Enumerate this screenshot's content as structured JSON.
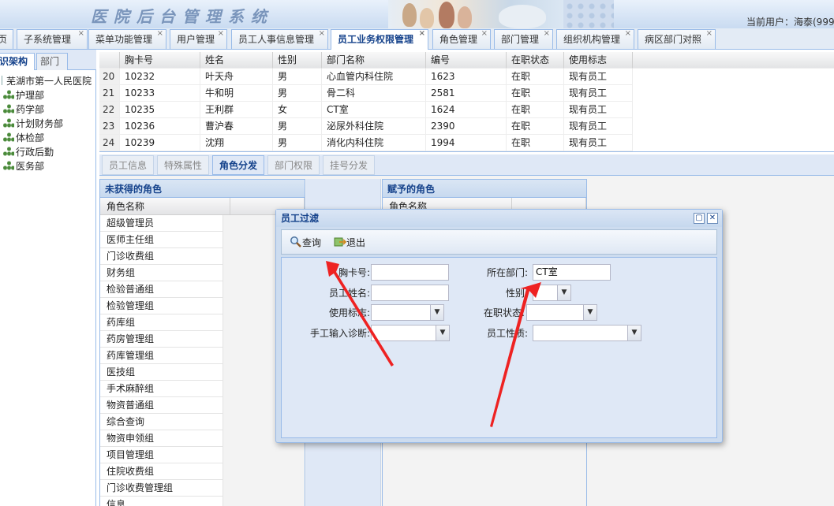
{
  "banner": {
    "title": "医院后台管理系统",
    "current_user": "当前用户：海泰(999"
  },
  "top_tabs": [
    {
      "label": "页",
      "active": false
    },
    {
      "label": "子系统管理",
      "active": false
    },
    {
      "label": "菜单功能管理",
      "active": false
    },
    {
      "label": "用户管理",
      "active": false
    },
    {
      "label": "员工人事信息管理",
      "active": false
    },
    {
      "label": "员工业务权限管理",
      "active": true
    },
    {
      "label": "角色管理",
      "active": false
    },
    {
      "label": "部门管理",
      "active": false
    },
    {
      "label": "组织机构管理",
      "active": false
    },
    {
      "label": "病区部门对照",
      "active": false
    }
  ],
  "left_panel": {
    "tabs": [
      "识架构",
      "部门"
    ],
    "root": "芜湖市第一人民医院",
    "nodes": [
      "护理部",
      "药学部",
      "计划财务部",
      "体检部",
      "行政后勤",
      "医务部"
    ]
  },
  "grid": {
    "headers": [
      "胸卡号",
      "姓名",
      "性别",
      "部门名称",
      "编号",
      "在职状态",
      "使用标志"
    ],
    "rows": [
      {
        "num": "20",
        "cells": [
          "10232",
          "叶天舟",
          "男",
          "心血管内科住院",
          "1623",
          "在职",
          "现有员工"
        ]
      },
      {
        "num": "21",
        "cells": [
          "10233",
          "牛和明",
          "男",
          "骨二科",
          "2581",
          "在职",
          "现有员工"
        ]
      },
      {
        "num": "22",
        "cells": [
          "10235",
          "王利群",
          "女",
          "CT室",
          "1624",
          "在职",
          "现有员工"
        ]
      },
      {
        "num": "23",
        "cells": [
          "10236",
          "曹沪春",
          "男",
          "泌尿外科住院",
          "2390",
          "在职",
          "现有员工"
        ]
      },
      {
        "num": "24",
        "cells": [
          "10239",
          "沈翔",
          "男",
          "消化内科住院",
          "1994",
          "在职",
          "现有员工"
        ]
      }
    ]
  },
  "sub_tabs": [
    {
      "label": "员工信息",
      "active": false
    },
    {
      "label": "特殊属性",
      "active": false
    },
    {
      "label": "角色分发",
      "active": true
    },
    {
      "label": "部门权限",
      "active": false
    },
    {
      "label": "挂号分发",
      "active": false
    }
  ],
  "unassigned_panel": {
    "title": "未获得的角色",
    "column": "角色名称",
    "roles": [
      "超级管理员",
      "医师主任组",
      "门诊收费组",
      "财务组",
      "检验普通组",
      "检验管理组",
      "药库组",
      "药房管理组",
      "药库管理组",
      "医技组",
      "手术麻醉组",
      "物资普通组",
      "综合查询",
      "物资申领组",
      "项目管理组",
      "住院收费组",
      "门诊收费管理组",
      "信息"
    ]
  },
  "assigned_panel": {
    "title": "赋予的角色",
    "column": "角色名称"
  },
  "dialog": {
    "title": "员工过滤",
    "query_label": "查询",
    "exit_label": "退出",
    "fields": {
      "card_no_label": "胸卡号:",
      "dept_label": "所在部门:",
      "dept_value": "CT室",
      "name_label": "员工姓名:",
      "gender_label": "性别:",
      "usage_label": "使用标志:",
      "status_label": "在职状态:",
      "manual_label": "手工输入诊断:",
      "nature_label": "员工性质:"
    }
  },
  "colors": {
    "accent": "#15428b",
    "border": "#99bbe8",
    "arrow": "#ee2222"
  }
}
